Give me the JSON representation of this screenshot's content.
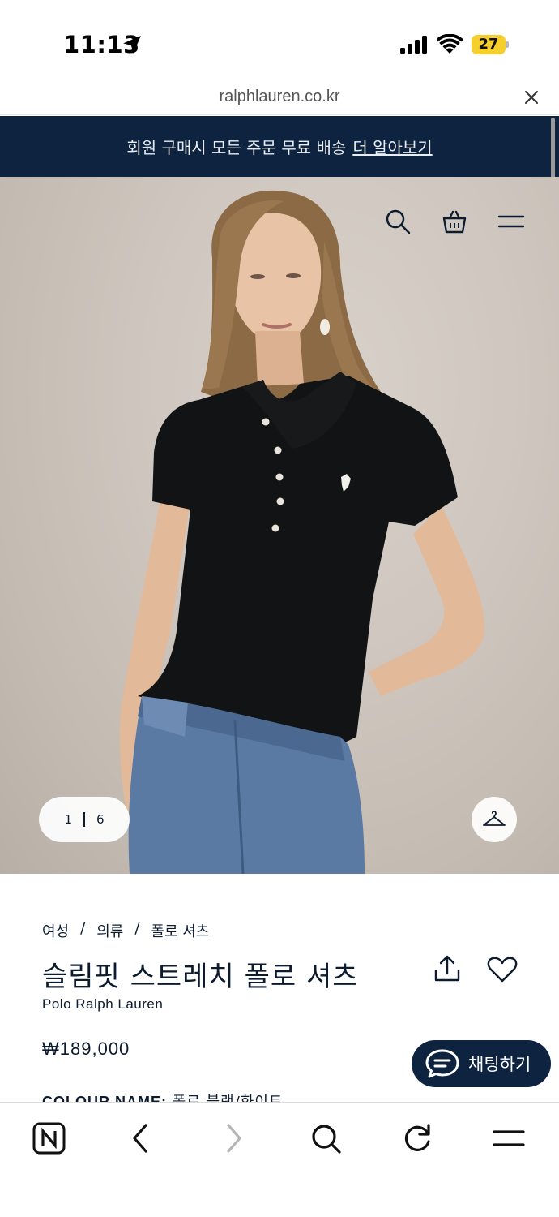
{
  "status_bar": {
    "time": "11:13",
    "battery": "27",
    "icons": [
      "location-arrow-icon",
      "signal-icon",
      "wifi-icon",
      "battery-icon"
    ]
  },
  "browser": {
    "url": "ralphlauren.co.kr"
  },
  "promo": {
    "text": "회원 구매시 모든 주문 무료 배송",
    "link": "더 알아보기",
    "background": "#0d2340"
  },
  "hero": {
    "pager_current": "1",
    "pager_total": "6",
    "icons": [
      "search-icon",
      "shopping-basket-icon",
      "menu-icon",
      "hanger-icon"
    ]
  },
  "product": {
    "breadcrumb": [
      "여성",
      "의류",
      "폴로 셔츠"
    ],
    "breadcrumb_separator": "/",
    "title": "슬림핏 스트레치 폴로 셔츠",
    "brand": "Polo Ralph Lauren",
    "price": "₩189,000",
    "colour_label": "COLOUR NAME:",
    "colour_value": "폴로 블랙/화이트"
  },
  "chat": {
    "label": "채팅하기"
  },
  "toolbar": {
    "icons": [
      "naver-n-icon",
      "back-arrow-icon",
      "forward-arrow-icon",
      "search-icon",
      "reload-icon",
      "menu-icon"
    ]
  },
  "colors": {
    "navy": "#0d2340",
    "battery": "#f6cf2d"
  }
}
